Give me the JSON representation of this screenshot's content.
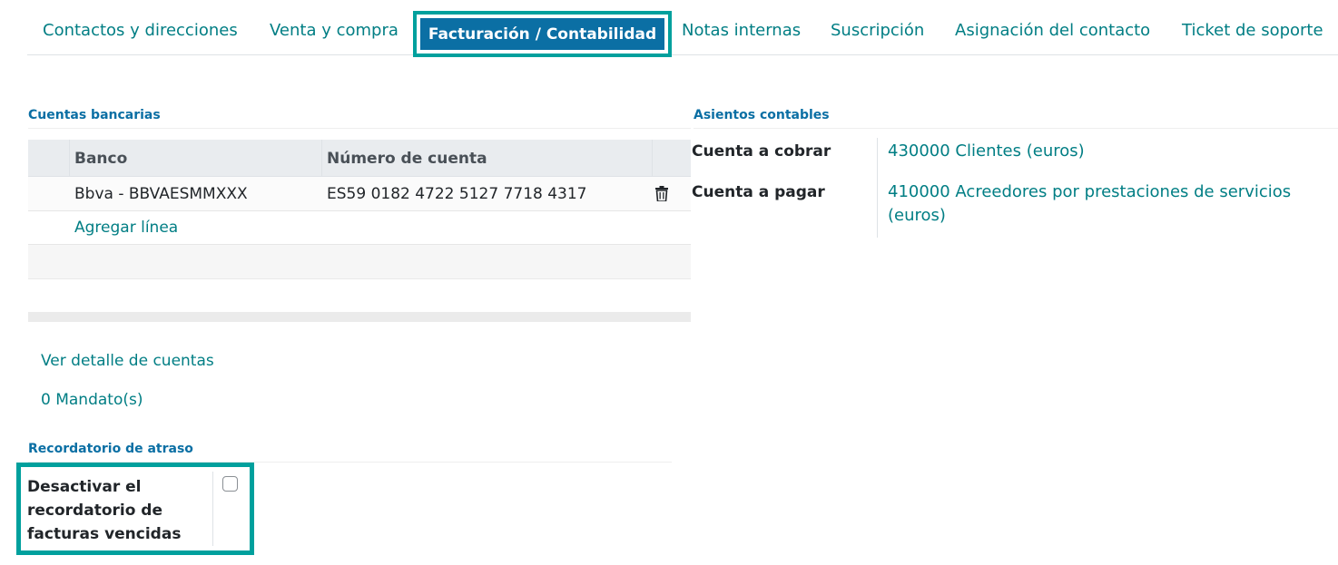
{
  "tabs": [
    {
      "label": "Contactos y direcciones",
      "active": false
    },
    {
      "label": "Venta y compra",
      "active": false
    },
    {
      "label": "Facturación / Contabilidad",
      "active": true
    },
    {
      "label": "Notas internas",
      "active": false
    },
    {
      "label": "Suscripción",
      "active": false
    },
    {
      "label": "Asignación del contacto",
      "active": false
    },
    {
      "label": "Ticket de soporte",
      "active": false
    }
  ],
  "bank_accounts": {
    "title": "Cuentas bancarias",
    "columns": [
      "Banco",
      "Número de cuenta"
    ],
    "rows": [
      {
        "bank": "Bbva - BBVAESMMXXX",
        "account_number": "ES59 0182 4722 5127 7718 4317",
        "delete_icon": "trash-icon"
      }
    ],
    "add_line": "Agregar línea"
  },
  "links": {
    "view_accounts": "Ver detalle de cuentas",
    "mandates": "0 Mandato(s)"
  },
  "accounting_entries": {
    "title": "Asientos contables",
    "receivable_label": "Cuenta a cobrar",
    "receivable_value": "430000 Clientes (euros)",
    "payable_label": "Cuenta a pagar",
    "payable_value": "410000 Acreedores por prestaciones de servicios (euros)"
  },
  "overdue_reminder": {
    "title": "Recordatorio de atraso",
    "disable_label": "Desactivar el recordatorio de facturas vencidas",
    "checked": false
  },
  "colors": {
    "link": "#017e84",
    "heading": "#0b6fa4",
    "active_tab_bg": "#0b6fa4",
    "highlight": "#00a09d"
  }
}
